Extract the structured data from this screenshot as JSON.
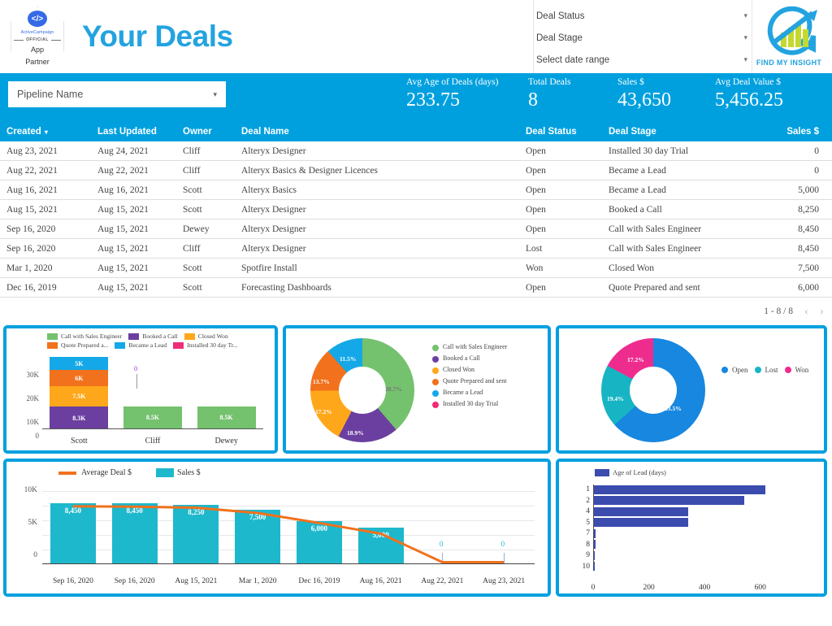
{
  "header": {
    "badge": {
      "brand": "ActiveCampaign",
      "code_icon": "</>",
      "official": "OFFICIAL",
      "line1": "App",
      "line2": "Partner"
    },
    "title": "Your Deals",
    "filters": [
      {
        "label": "Deal Status",
        "caret": "▾"
      },
      {
        "label": "Deal Stage",
        "caret": "▾"
      },
      {
        "label": "Select date range",
        "caret": "▾"
      }
    ],
    "logo_text": "FIND MY INSIGHT"
  },
  "kpi_band": {
    "pipeline_select": {
      "value": "Pipeline Name",
      "caret": "▾"
    },
    "kpis": [
      {
        "label": "Avg Age of Deals (days)",
        "value": "233.75"
      },
      {
        "label": "Total Deals",
        "value": "8"
      },
      {
        "label": "Sales $",
        "value": "43,650"
      },
      {
        "label": "Avg Deal Value $",
        "value": "5,456.25"
      }
    ]
  },
  "table": {
    "columns": [
      "Created",
      "Last Updated",
      "Owner",
      "Deal Name",
      "Deal Status",
      "Deal Stage",
      "Sales $"
    ],
    "sort_caret": "▾",
    "rows": [
      {
        "created": "Aug 23, 2021",
        "updated": "Aug 24, 2021",
        "owner": "Cliff",
        "deal": "Alteryx Designer",
        "status": "Open",
        "stage": "Installed 30 day Trial",
        "sales": "0"
      },
      {
        "created": "Aug 22, 2021",
        "updated": "Aug 22, 2021",
        "owner": "Cliff",
        "deal": "Alteryx Basics & Designer Licences",
        "status": "Open",
        "stage": "Became a Lead",
        "sales": "0"
      },
      {
        "created": "Aug 16, 2021",
        "updated": "Aug 16, 2021",
        "owner": "Scott",
        "deal": "Alteryx Basics",
        "status": "Open",
        "stage": "Became a Lead",
        "sales": "5,000"
      },
      {
        "created": "Aug 15, 2021",
        "updated": "Aug 15, 2021",
        "owner": "Scott",
        "deal": "Alteryx Designer",
        "status": "Open",
        "stage": "Booked a Call",
        "sales": "8,250"
      },
      {
        "created": "Sep 16, 2020",
        "updated": "Aug 15, 2021",
        "owner": "Dewey",
        "deal": "Alteryx Designer",
        "status": "Open",
        "stage": "Call with Sales Engineer",
        "sales": "8,450"
      },
      {
        "created": "Sep 16, 2020",
        "updated": "Aug 15, 2021",
        "owner": "Cliff",
        "deal": "Alteryx Designer",
        "status": "Lost",
        "stage": "Call with Sales Engineer",
        "sales": "8,450"
      },
      {
        "created": "Mar 1, 2020",
        "updated": "Aug 15, 2021",
        "owner": "Scott",
        "deal": "Spotfire Install",
        "status": "Won",
        "stage": "Closed Won",
        "sales": "7,500"
      },
      {
        "created": "Dec 16, 2019",
        "updated": "Aug 15, 2021",
        "owner": "Scott",
        "deal": "Forecasting Dashboards",
        "status": "Open",
        "stage": "Quote Prepared and sent",
        "sales": "6,000"
      }
    ],
    "pagination": {
      "range": "1 - 8 / 8",
      "prev": "‹",
      "next": "›"
    }
  },
  "colors": {
    "brand_blue": "#00A0DF",
    "title_blue": "#23A3E0",
    "green": "#74C16E",
    "purple": "#6B3FA0",
    "amber": "#FFA71A",
    "orange": "#F2711C",
    "sky": "#14A8E8",
    "pink": "#EE2C78",
    "teal": "#1EB8CC",
    "indigo": "#3B4BAE",
    "dodger": "#1787E0",
    "cyan": "#17B5C4",
    "magenta": "#EE2C8E"
  },
  "chart_data": [
    {
      "id": "stacked-sales-by-owner",
      "type": "bar",
      "stacked": true,
      "title": "",
      "categories": [
        "Scott",
        "Cliff",
        "Dewey"
      ],
      "ylabel": "",
      "ylim": [
        0,
        30000
      ],
      "yticks": [
        "0",
        "10K",
        "20K",
        "30K"
      ],
      "legend_position": "top",
      "series": [
        {
          "name": "Call with Sales Engineer",
          "color": "#74C16E",
          "values": [
            0,
            8500,
            8500
          ],
          "labels": [
            "",
            "8.5K",
            "8.5K"
          ]
        },
        {
          "name": "Booked a Call",
          "color": "#6B3FA0",
          "values": [
            8300,
            0,
            0
          ],
          "labels": [
            "8.3K",
            "",
            ""
          ]
        },
        {
          "name": "Closed Won",
          "color": "#FFA71A",
          "values": [
            7500,
            0,
            0
          ],
          "labels": [
            "7.5K",
            "",
            ""
          ]
        },
        {
          "name": "Quote Prepared a...",
          "color": "#F2711C",
          "values": [
            6000,
            0,
            0
          ],
          "labels": [
            "6K",
            "",
            ""
          ]
        },
        {
          "name": "Became a Lead",
          "color": "#14A8E8",
          "values": [
            5000,
            0,
            0
          ],
          "labels": [
            "5K",
            "",
            ""
          ]
        },
        {
          "name": "Installed 30 day Tr...",
          "color": "#EE2C78",
          "values": [
            0,
            0,
            0
          ],
          "labels": [
            "",
            "0",
            ""
          ]
        }
      ],
      "annotations": [
        {
          "category": "Cliff",
          "text": "0"
        }
      ]
    },
    {
      "id": "donut-deal-stage",
      "type": "pie",
      "donut": true,
      "title": "",
      "legend_position": "right",
      "labels": [
        "Call with Sales Engineer",
        "Booked a Call",
        "Closed Won",
        "Quote Prepared and sent",
        "Became a Lead",
        "Installed 30 day Trial"
      ],
      "values": [
        38.7,
        18.9,
        17.2,
        13.7,
        11.5,
        0
      ],
      "value_labels": [
        "38.7%",
        "18.9%",
        "17.2%",
        "13.7%",
        "11.5%",
        ""
      ],
      "colors": [
        "#74C16E",
        "#6B3FA0",
        "#FFA71A",
        "#F2711C",
        "#14A8E8",
        "#EE2C78"
      ]
    },
    {
      "id": "donut-deal-status",
      "type": "pie",
      "donut": true,
      "title": "",
      "legend_position": "right",
      "labels": [
        "Open",
        "Lost",
        "Won"
      ],
      "values": [
        63.5,
        19.4,
        17.2
      ],
      "value_labels": [
        "63.5%",
        "19.4%",
        "17.2%"
      ],
      "colors": [
        "#1787E0",
        "#17B5C4",
        "#EE2C8E"
      ]
    },
    {
      "id": "combo-sales-avg-deal",
      "type": "bar",
      "title": "",
      "legend_position": "top",
      "legend": [
        "Average Deal $",
        "Sales $"
      ],
      "categories": [
        "Sep 16, 2020",
        "Sep 16, 2020",
        "Aug 15, 2021",
        "Mar 1, 2020",
        "Dec 16, 2019",
        "Aug 16, 2021",
        "Aug 22, 2021",
        "Aug 23, 2021"
      ],
      "ylim": [
        0,
        11000
      ],
      "yticks": [
        "0",
        "5K",
        "10K"
      ],
      "series": [
        {
          "name": "Sales $",
          "kind": "bar",
          "color": "#1EB8CC",
          "values": [
            8450,
            8450,
            8250,
            7500,
            6000,
            5000,
            0,
            0
          ],
          "labels": [
            "8,450",
            "8,450",
            "8,250",
            "7,500",
            "6,000",
            "5,000",
            "0",
            "0"
          ]
        },
        {
          "name": "Average Deal $",
          "kind": "line",
          "color": "#F2711C",
          "values": [
            8700,
            8650,
            8500,
            7700,
            6200,
            4600,
            300,
            300
          ]
        }
      ]
    },
    {
      "id": "hbar-age-of-lead",
      "type": "bar",
      "orientation": "horizontal",
      "title": "",
      "legend": [
        "Age of Lead (days)"
      ],
      "legend_position": "top",
      "color": "#3B4BAE",
      "categories": [
        "1",
        "2",
        "4",
        "5",
        "7",
        "8",
        "9",
        "10"
      ],
      "values": [
        618,
        543,
        342,
        342,
        8,
        8,
        2,
        1
      ],
      "xlim": [
        0,
        700
      ],
      "xticks": [
        "0",
        "200",
        "400",
        "600"
      ],
      "xtick_values": [
        0,
        200,
        400,
        600
      ]
    }
  ]
}
